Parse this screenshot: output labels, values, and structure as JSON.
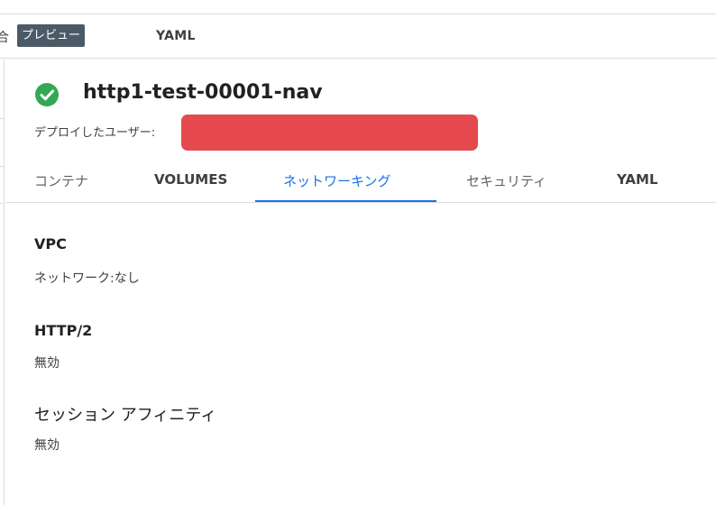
{
  "topbar": {
    "cut_char": "合",
    "preview_badge": "プレビュー",
    "yaml_tab": "YAML"
  },
  "header": {
    "title": "http1-test-00001-nav",
    "deployer_label": "デプロイしたユーザー:",
    "status_icon": "check-circle-icon"
  },
  "tabs": [
    {
      "label": "コンテナ"
    },
    {
      "label": "VOLUMES"
    },
    {
      "label": "ネットワーキング",
      "active": true
    },
    {
      "label": "セキュリティ"
    },
    {
      "label": "YAML"
    }
  ],
  "sections": [
    {
      "title": "VPC",
      "value": "ネットワーク:なし"
    },
    {
      "title": "HTTP/2",
      "value": "無効"
    },
    {
      "title": "セッション アフィニティ",
      "value": "無効"
    }
  ],
  "colors": {
    "accent": "#1a73e8",
    "success": "#34a853",
    "redaction": "#e5494d",
    "badge": "#4c5a67"
  }
}
